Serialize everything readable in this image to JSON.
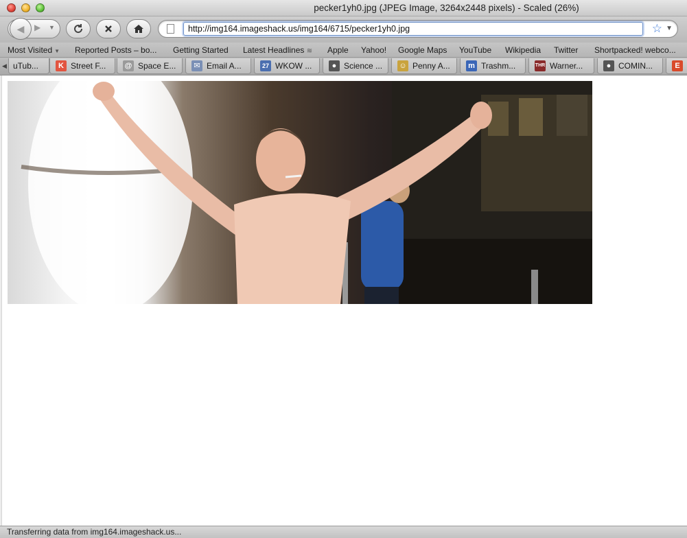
{
  "window": {
    "title": "pecker1yh0.jpg (JPEG Image, 3264x2448 pixels) - Scaled (26%)"
  },
  "toolbar": {
    "url": "http://img164.imageshack.us/img164/6715/pecker1yh0.jpg",
    "icons": [
      "back-icon",
      "forward-icon",
      "history-dropdown-icon",
      "reload-icon",
      "stop-icon",
      "home-icon",
      "page-icon",
      "star-icon",
      "url-dropdown-icon"
    ]
  },
  "bookmarks": [
    {
      "label": "Most Visited",
      "dropdown": true
    },
    {
      "label": "Reported Posts – bo..."
    },
    {
      "label": "Getting Started"
    },
    {
      "label": "Latest Headlines",
      "rss": true
    },
    {
      "label": "Apple"
    },
    {
      "label": "Yahoo!"
    },
    {
      "label": "Google Maps"
    },
    {
      "label": "YouTube"
    },
    {
      "label": "Wikipedia"
    },
    {
      "label": "Twitter"
    },
    {
      "label": "Shortpacked! webco..."
    }
  ],
  "tabs": [
    {
      "label": "uTub..."
    },
    {
      "label": "Street F...",
      "icon": "K",
      "color": "#e2543f"
    },
    {
      "label": "Space E...",
      "icon": "@",
      "color": "#9a9a9a"
    },
    {
      "label": "Email A...",
      "icon": "✉",
      "color": "#7a8fb5"
    },
    {
      "label": "WKOW ...",
      "icon": "27",
      "color": "#4b6fb0"
    },
    {
      "label": "Science ...",
      "icon": "●",
      "color": "#555555"
    },
    {
      "label": "Penny A...",
      "icon": "☺",
      "color": "#c9a33e"
    },
    {
      "label": "Trashm...",
      "icon": "m",
      "color": "#3a66b7"
    },
    {
      "label": "Warner...",
      "icon": "THR",
      "color": "#8a2a2a"
    },
    {
      "label": "COMIN...",
      "icon": "●",
      "color": "#555555"
    },
    {
      "label": "",
      "icon": "E",
      "color": "#d94a2b"
    }
  ],
  "status": {
    "text": "Transferring data from img164.imageshack.us..."
  }
}
